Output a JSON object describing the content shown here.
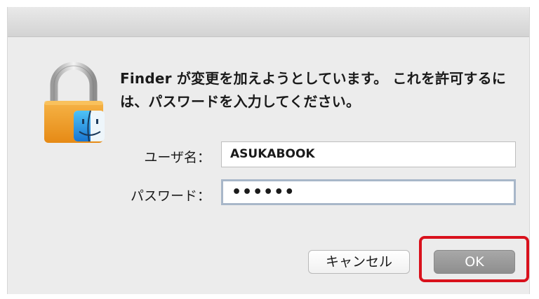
{
  "dialog": {
    "message": "Finder が変更を加えようとしています。 これを許可するには、パスワードを入力してください。",
    "icon": "lock-finder-icon"
  },
  "form": {
    "username_label": "ユーザ名：",
    "username_value": "ASUKABOOK",
    "password_label": "パスワード：",
    "password_value": "••••••"
  },
  "buttons": {
    "cancel_label": "キャンセル",
    "ok_label": "OK"
  },
  "colors": {
    "highlight": "#d9111c",
    "dialog_bg": "#ececec",
    "ok_button": "#999999"
  }
}
